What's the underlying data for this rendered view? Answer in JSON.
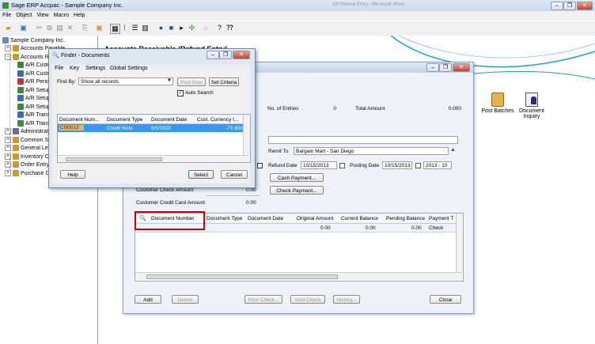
{
  "app": {
    "title": "Sage ERP Accpac - Sample Company Inc.",
    "background_doc_title": "AR Refund Entry - Microsoft Word"
  },
  "menu": [
    "File",
    "Object",
    "View",
    "Macro",
    "Help"
  ],
  "tree": {
    "root": "Sample Company Inc.",
    "items": [
      {
        "label": "Accounts Payable",
        "level": 1,
        "icon": "folder-icon",
        "color": "#c99a2e"
      },
      {
        "label": "Accounts Receivable",
        "level": 1,
        "icon": "folder-icon",
        "color": "#c99a2e"
      },
      {
        "label": "A/R Customers",
        "level": 2,
        "icon": "ar-icon",
        "color": "#3a8a3a"
      },
      {
        "label": "A/R Customers",
        "level": 2,
        "icon": "ar-icon",
        "color": "#3a6ab8"
      },
      {
        "label": "A/R Periodic Processing",
        "level": 2,
        "icon": "ar-icon",
        "color": "#b83a3a"
      },
      {
        "label": "A/R Setup",
        "level": 2,
        "icon": "ar-icon",
        "color": "#3a8a3a"
      },
      {
        "label": "A/R Setup Reports",
        "level": 2,
        "icon": "ar-icon",
        "color": "#3a6ab8"
      },
      {
        "label": "A/R Setup Forms",
        "level": 2,
        "icon": "ar-icon",
        "color": "#3a8a3a"
      },
      {
        "label": "A/R Transactions",
        "level": 2,
        "icon": "ar-icon",
        "color": "#3a6ab8"
      },
      {
        "label": "A/R Transaction Reports",
        "level": 2,
        "icon": "ar-icon",
        "color": "#3a8a3a"
      },
      {
        "label": "Administrative Services",
        "level": 1,
        "icon": "admin-icon",
        "color": "#6a6a9a"
      },
      {
        "label": "Common Services",
        "level": 1,
        "icon": "folder-icon",
        "color": "#c99a2e"
      },
      {
        "label": "General Ledger",
        "level": 1,
        "icon": "folder-icon",
        "color": "#c99a2e"
      },
      {
        "label": "Inventory Control",
        "level": 1,
        "icon": "folder-icon",
        "color": "#c99a2e"
      },
      {
        "label": "Order Entry",
        "level": 1,
        "icon": "folder-icon",
        "color": "#c99a2e"
      },
      {
        "label": "Purchase Orders",
        "level": 1,
        "icon": "folder-icon",
        "color": "#c99a2e"
      }
    ]
  },
  "workspace": {
    "title_partial": "Accounts Receivable (Refund Entry)",
    "shortcuts": [
      {
        "label": "Post Batches",
        "icon": "post-batches-icon"
      },
      {
        "label": "Document Inquiry",
        "icon": "document-inquiry-icon"
      }
    ]
  },
  "ar": {
    "no_entries_label": "No. of Entries",
    "no_entries_value": "0",
    "total_amount_label": "Total Amount",
    "total_amount_value": "0.000",
    "remit_to_label": "Remit To",
    "remit_to_value": "Bargain Mart - San Diego",
    "refund_date_label": "Refund Date",
    "refund_date_value": "10/15/2013",
    "posting_date_label": "Posting Date",
    "posting_date_value": "10/15/2013",
    "period_value": "2013 - 10",
    "cash_payment_button": "Cash Payment...",
    "check_payment_button": "Check Payment...",
    "check_amount_label": "Customer Check Amount",
    "check_amount_value": "0.00",
    "credit_card_label": "Customer Credit Card Amount",
    "credit_card_value": "0.00",
    "grid": {
      "columns": [
        "Document Number",
        "Document Type",
        "Document Date",
        "Original Amount",
        "Current Balance",
        "Pending Balance",
        "Payment T"
      ],
      "row": [
        "",
        "",
        "",
        "0.00",
        "0.00",
        "0.00",
        "Check"
      ]
    },
    "buttons": {
      "add": "Add",
      "delete": "Delete",
      "print_check": "Print Check...",
      "void_check": "Void Check",
      "history": "History...",
      "close": "Close"
    }
  },
  "finder": {
    "title": "Finder - Documents",
    "menu": [
      "File",
      "Key",
      "Settings",
      "Global Settings"
    ],
    "find_by_label": "Find By:",
    "find_by_value": "Show all records",
    "find_now": "Find Now",
    "set_criteria": "Set Criteria",
    "auto_search": "Auto Search",
    "columns": [
      "Document Num...",
      "Document Type",
      "Document Date",
      "Cust. Currency I..."
    ],
    "rows": [
      [
        "CN0012",
        "Credit Note",
        "6/5/2020",
        "-78.600"
      ]
    ],
    "help": "Help",
    "select": "Select",
    "cancel": "Cancel"
  },
  "colors": {
    "highlight_box": "#cc0000",
    "selected_row": "#3399ff",
    "accent_teal": "#18a0c8"
  }
}
